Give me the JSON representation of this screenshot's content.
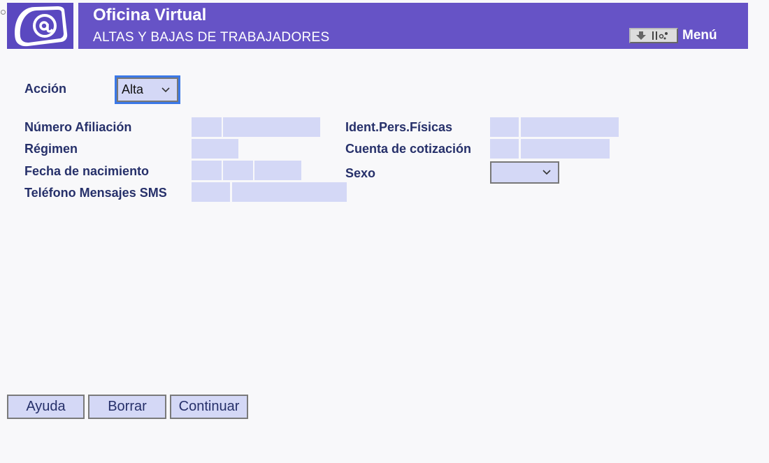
{
  "header": {
    "title": "Oficina Virtual",
    "subtitle": "ALTAS Y BAJAS DE TRABAJADORES",
    "menu_label": "Menú"
  },
  "form": {
    "accion_label": "Acción",
    "accion_value": "Alta",
    "numero_afiliacion_label": "Número Afiliación",
    "regimen_label": "Régimen",
    "fecha_nacimiento_label": "Fecha de nacimiento",
    "telefono_sms_label": "Teléfono Mensajes SMS",
    "ident_pers_fisicas_label": "Ident.Pers.Físicas",
    "cuenta_cotizacion_label": "Cuenta de cotización",
    "sexo_label": "Sexo",
    "sexo_value": ""
  },
  "buttons": {
    "ayuda": "Ayuda",
    "borrar": "Borrar",
    "continuar": "Continuar"
  },
  "colors": {
    "header": "#6653c6",
    "field": "#d4d8f6",
    "label": "#26306a",
    "focus": "#3b78e7"
  },
  "icons": {
    "logo": "at-sign-logo-icon",
    "menu": "menu-arrow-icon"
  }
}
